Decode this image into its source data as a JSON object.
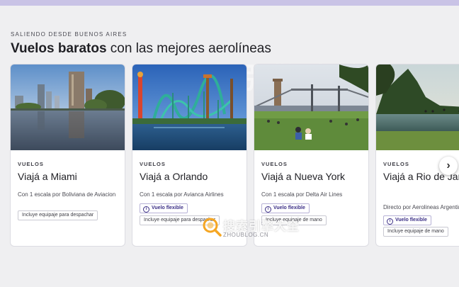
{
  "section": {
    "kicker": "SALIENDO DESDE BUENOS AIRES",
    "title_bold": "Vuelos baratos",
    "title_rest": " con las mejores aerolíneas"
  },
  "cards": [
    {
      "label": "VUELOS",
      "destination": "Viajá a Miami",
      "description": "Con 1 escala por Boliviana de Aviacion",
      "badge": "",
      "chip": "Incluye equipaje para despachar",
      "photo": "miami-skyline"
    },
    {
      "label": "VUELOS",
      "destination": "Viajá a Orlando",
      "description": "Con 1 escala por Avianca Airlines",
      "badge": "Vuelo flexible",
      "chip": "Incluye equipaje para despachar",
      "photo": "orlando-rollercoaster"
    },
    {
      "label": "VUELOS",
      "destination": "Viajá a Nueva York",
      "description": "Con 1 escala por Delta Air Lines",
      "badge": "Vuelo flexible",
      "chip": "Incluye equipaje de mano",
      "photo": "new-york-park"
    },
    {
      "label": "VUELOS",
      "destination": "Viajá a Rio de Janeiro",
      "description": "Directo por Aerolineas Argentinas",
      "badge": "Vuelo flexible",
      "chip": "Incluye equipaje de mano",
      "photo": "rio-lagoon"
    }
  ],
  "carousel": {
    "next_icon": "chevron-right-icon",
    "next_glyph": "›"
  },
  "watermark": {
    "title": "搜索引擎大全",
    "subtitle": "ZHOUBLOG.CN"
  },
  "colors": {
    "accent": "#3b2f86",
    "topbar": "#c9c3e6",
    "background": "#efeff1"
  }
}
